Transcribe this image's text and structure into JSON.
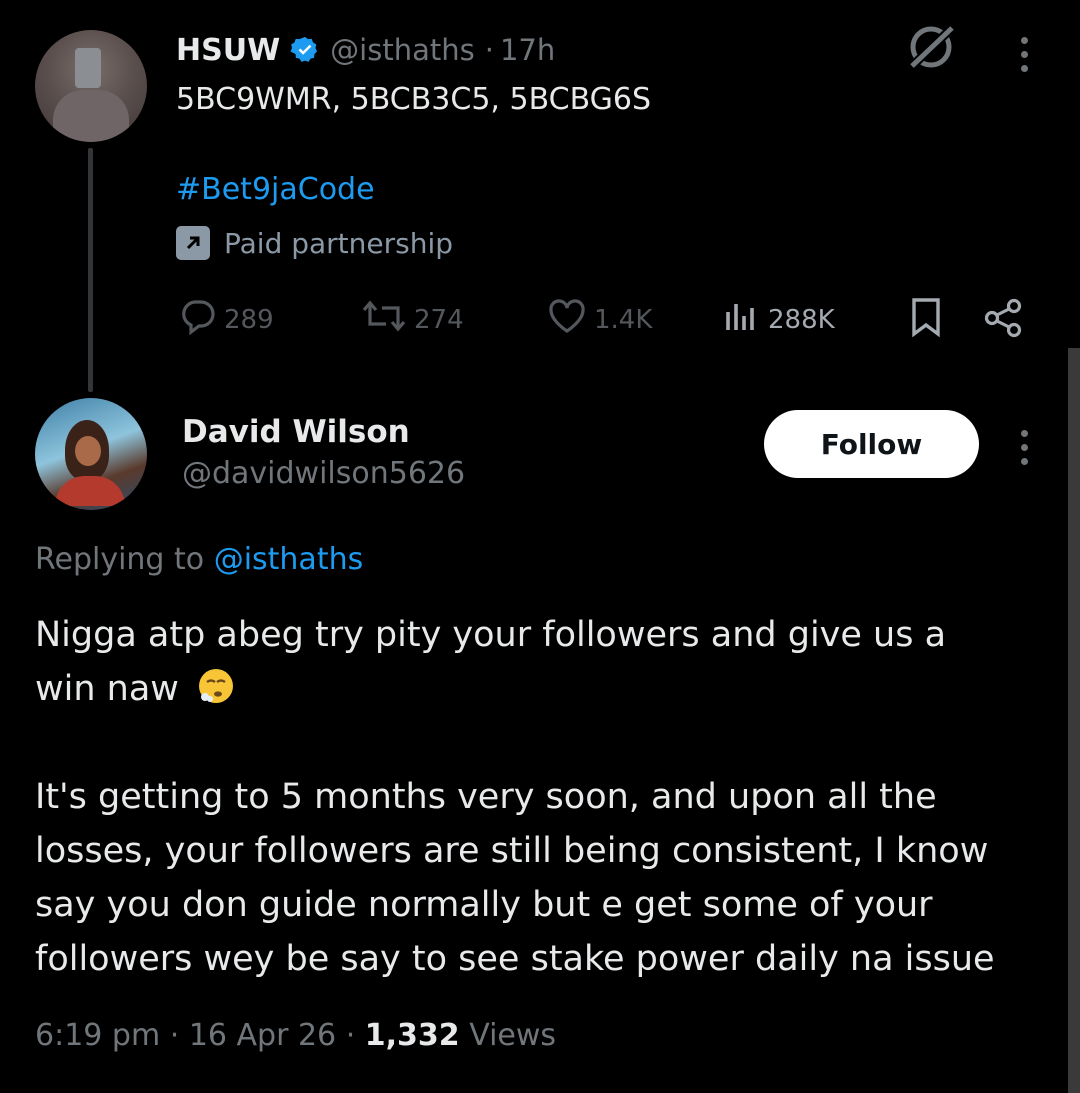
{
  "original_tweet": {
    "author_name": "HSUW",
    "handle": "@isthaths",
    "time": "17h",
    "separator": "·",
    "text": "5BC9WMR, 5BCB3C5, 5BCBG6S",
    "hashtag": "#Bet9jaCode",
    "paid_label": "Paid partnership",
    "actions": {
      "replies": "289",
      "retweets": "274",
      "likes": "1.4K",
      "views": "288K"
    }
  },
  "reply": {
    "author_name": "David Wilson",
    "handle": "@davidwilson5626",
    "follow_label": "Follow",
    "replying_prefix": "Replying to",
    "replying_handle": "@isthaths",
    "text_line1": "Nigga atp abeg try pity your followers and give us a",
    "text_line2": "win naw",
    "emoji": "😮‍💨",
    "paragraph2": [
      "It's getting to 5 months very soon, and upon all the",
      "losses, your followers are still being consistent, I know",
      "say you don guide normally but e get some of your",
      "followers wey be say to see stake power daily na issue"
    ],
    "time": "6:19 pm",
    "date": "16 Apr 26",
    "views_count": "1,332",
    "views_label": "Views"
  },
  "colors": {
    "background": "#000000",
    "text": "#e7e9ea",
    "muted": "#71767b",
    "link": "#1d9bf0",
    "verified": "#1d9bf0"
  },
  "icons": [
    "verified-badge-icon",
    "grok-icon",
    "more-icon",
    "paid-partnership-icon",
    "reply-icon",
    "retweet-icon",
    "like-icon",
    "views-icon",
    "bookmark-icon",
    "share-icon"
  ]
}
